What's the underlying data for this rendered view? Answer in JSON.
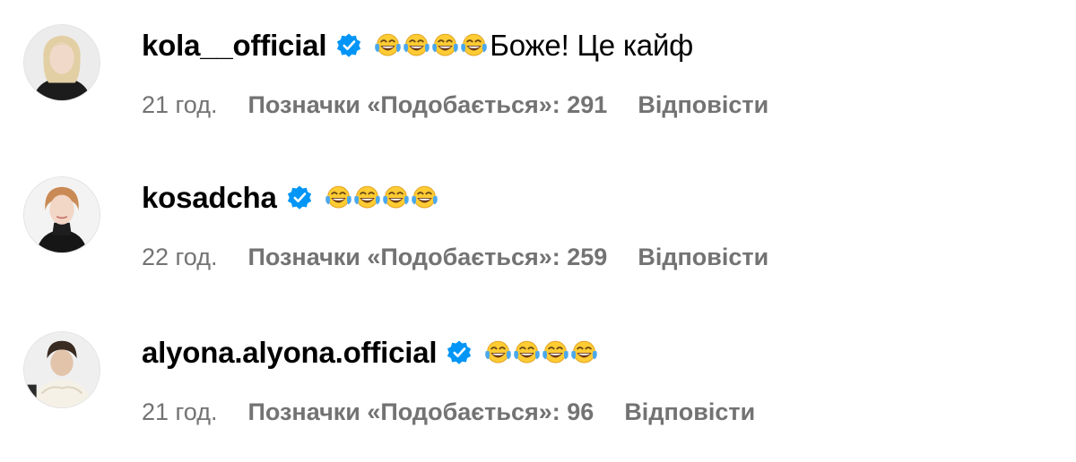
{
  "comments": [
    {
      "username": "kola__official",
      "emojis": [
        "tears-of-joy-emoji",
        "tears-of-joy-emoji",
        "tears-of-joy-emoji",
        "tears-of-joy-emoji"
      ],
      "text": "Боже! Це кайф",
      "time": "21 год.",
      "likes": "Позначки «Подобається»: 291",
      "reply": "Відповісти"
    },
    {
      "username": "kosadcha",
      "emojis": [
        "tears-of-joy-emoji",
        "tears-of-joy-emoji",
        "tears-of-joy-emoji",
        "tears-of-joy-emoji"
      ],
      "text": "",
      "time": "22 год.",
      "likes": "Позначки «Подобається»: 259",
      "reply": "Відповісти"
    },
    {
      "username": "alyona.alyona.official",
      "emojis": [
        "tears-of-joy-emoji",
        "tears-of-joy-emoji",
        "tears-of-joy-emoji",
        "tears-of-joy-emoji"
      ],
      "text": "",
      "time": "21 год.",
      "likes": "Позначки «Подобається»: 96",
      "reply": "Відповісти"
    }
  ],
  "icons": {
    "verified": "verified-badge-icon",
    "emoji": "tears-of-joy-emoji"
  },
  "colors": {
    "text": "#000000",
    "meta": "#737373",
    "verified": "#0095f6",
    "emoji": "#ffcc33"
  }
}
